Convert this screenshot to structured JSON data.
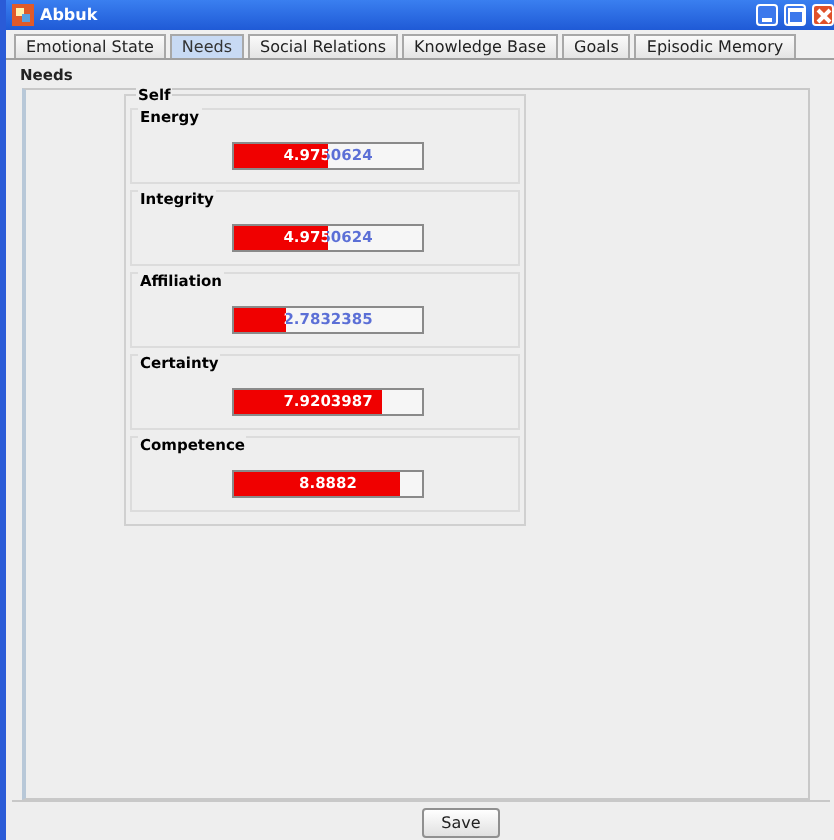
{
  "window": {
    "title": "Abbuk"
  },
  "tabs": [
    {
      "label": "Emotional State",
      "selected": false
    },
    {
      "label": "Needs",
      "selected": true
    },
    {
      "label": "Social Relations",
      "selected": false
    },
    {
      "label": "Knowledge Base",
      "selected": false
    },
    {
      "label": "Goals",
      "selected": false
    },
    {
      "label": "Episodic Memory",
      "selected": false
    }
  ],
  "panel_title": "Needs",
  "group": {
    "title": "Self",
    "needs": [
      {
        "name": "Energy",
        "level": 0.497,
        "reading": "4.9750624"
      },
      {
        "name": "Integrity",
        "level": 0.497,
        "reading": "4.9750624"
      },
      {
        "name": "Affiliation",
        "level": 0.278,
        "reading": "2.7832385"
      },
      {
        "name": "Certainty",
        "level": 0.792,
        "reading": "7.9203987"
      },
      {
        "name": "Competence",
        "level": 0.888,
        "reading": "8.8882"
      }
    ]
  },
  "buttons": [
    "Save"
  ]
}
